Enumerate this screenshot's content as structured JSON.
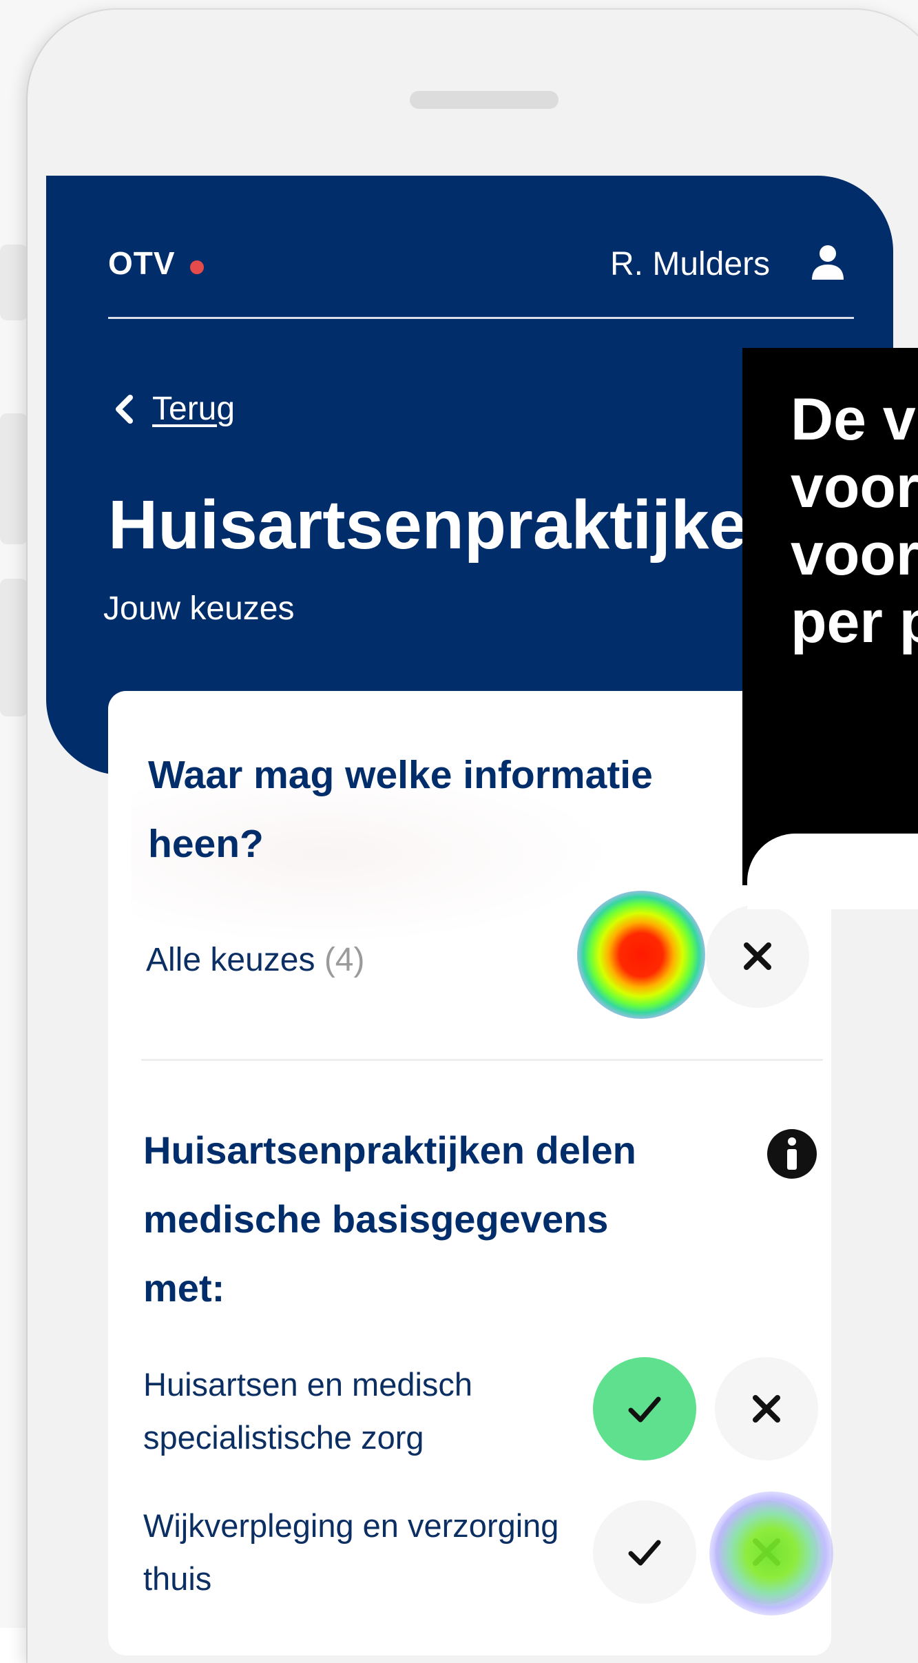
{
  "header": {
    "brand": "OTV",
    "user_name": "R. Mulders",
    "back_label": "Terug",
    "page_title": "Huisartsenpraktijken",
    "page_subtitle": "Jouw keuzes"
  },
  "card": {
    "title": "Waar mag welke informatie heen?",
    "all_choices_label": "Alle keuzes",
    "all_choices_count": "(4)"
  },
  "section": {
    "title": "Huisartsenpraktijken delen medische basisgegevens met:",
    "rows": [
      {
        "label": "Huisartsen en medisch specialistische zorg",
        "state": "accepted"
      },
      {
        "label": "Wijkverpleging en verzorging thuis",
        "state": "none"
      }
    ]
  },
  "callout": {
    "text": "De v\nvoor\nvoor\nper p"
  },
  "colors": {
    "header_bg": "#012d6b",
    "accept_green": "#5ee08e",
    "text_navy": "#0b2e63",
    "brand_dot": "#e64b4b"
  },
  "icons": [
    "user-icon",
    "chevron-left-icon",
    "info-icon",
    "check-icon",
    "close-icon"
  ]
}
